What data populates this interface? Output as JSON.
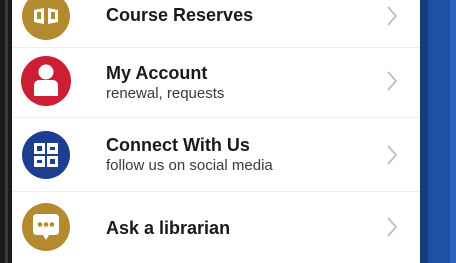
{
  "menu": {
    "items": [
      {
        "title": "Course Reserves",
        "subtitle": "",
        "icon": "course-reserves-icon",
        "color": "#b38a2e"
      },
      {
        "title": "My Account",
        "subtitle": "renewal, requests",
        "icon": "person-icon",
        "color": "#cc1f34"
      },
      {
        "title": "Connect With Us",
        "subtitle": "follow us on social media",
        "icon": "social-media-icon",
        "color": "#1c3f8f"
      },
      {
        "title": "Ask a librarian",
        "subtitle": "",
        "icon": "chat-bubble-icon",
        "color": "#b38a2e"
      }
    ]
  }
}
